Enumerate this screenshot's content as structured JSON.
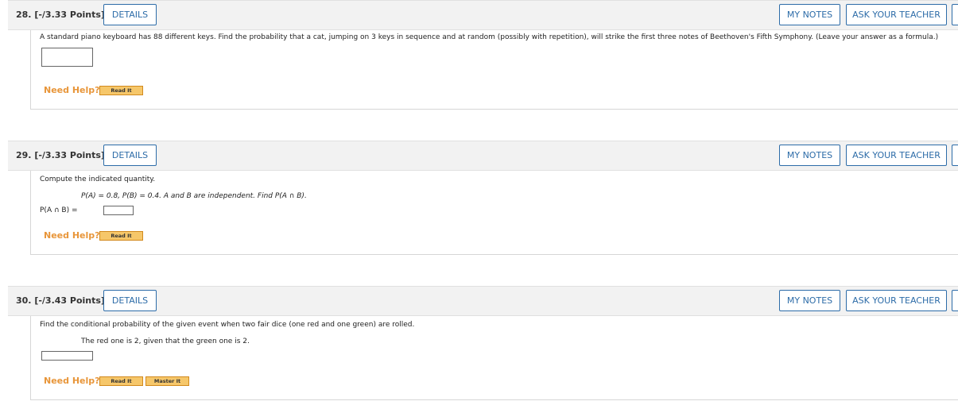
{
  "buttons": {
    "details": "DETAILS",
    "my_notes": "MY NOTES",
    "ask_teacher": "ASK YOUR TEACHER"
  },
  "help": {
    "need_help": "Need Help?",
    "read_it": "Read It",
    "master_it": "Master It"
  },
  "questions": [
    {
      "header": "28. [-/3.33 Points]",
      "text": "A standard piano keyboard has 88 different keys. Find the probability that a cat, jumping on 3 keys in sequence and at random (possibly with repetition), will strike the first three notes of Beethoven's Fifth Symphony. (Leave your answer as a formula.)",
      "answer_value": ""
    },
    {
      "header": "29. [-/3.33 Points]",
      "prompt": "Compute the indicated quantity.",
      "given": "P(A) = 0.8, P(B) = 0.4. A and B are independent. Find P(A ∩ B).",
      "answer_label": "P(A ∩ B) =",
      "answer_value": ""
    },
    {
      "header": "30. [-/3.43 Points]",
      "prompt": "Find the conditional probability of the given event when two fair dice (one red and one green) are rolled.",
      "given": "The red one is 2, given that the green one is 2.",
      "answer_value": ""
    }
  ],
  "colors": {
    "accent_blue": "#2d6ca8",
    "need_help_orange": "#e8963a",
    "help_button_fill": "#f6c76a",
    "header_bg": "#f2f2f2"
  }
}
